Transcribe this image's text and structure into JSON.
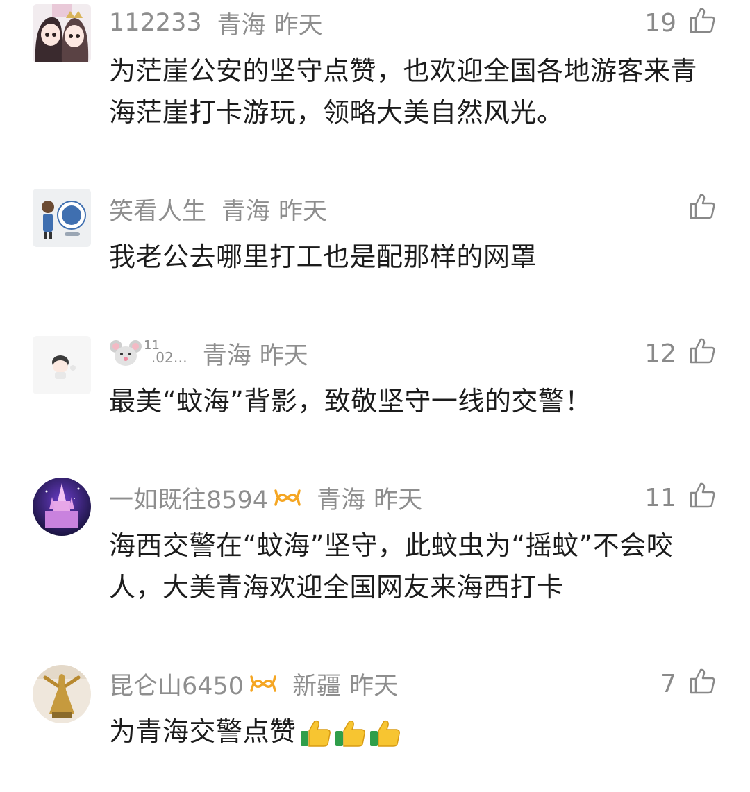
{
  "comments": [
    {
      "username": "112233",
      "location": "青海",
      "time": "昨天",
      "likes": "19",
      "text": "为茫崖公安的坚守点赞，也欢迎全国各地游客来青海茫崖打卡游玩，领略大美自然风光。",
      "avatar": "anime-couple-avatar"
    },
    {
      "username": "笑看人生",
      "location": "青海",
      "time": "昨天",
      "likes": "",
      "text": "我老公去哪里打工也是配那样的网罩",
      "avatar": "cartoon-character-avatar"
    },
    {
      "username_emoji": "mouse-face-emoji",
      "username_sup": "11",
      "username_sub": ".02…",
      "location": "青海",
      "time": "昨天",
      "likes": "12",
      "text": "最美“蚊海”背影，致敬坚守一线的交警！",
      "avatar": "small-doll-avatar"
    },
    {
      "username": "一如既往8594",
      "badge": "orange-vip-badge",
      "location": "青海",
      "time": "昨天",
      "likes": "11",
      "text": "海西交警在“蚊海”坚守，此蚊虫为“摇蚊”不会咬人，大美青海欢迎全国网友来海西打卡",
      "avatar": "purple-castle-avatar"
    },
    {
      "username": "昆仑山6450",
      "badge": "orange-vip-badge",
      "location": "新疆",
      "time": "昨天",
      "likes": "7",
      "text": "为青海交警点赞",
      "text_emoji": "thumbs-up-emoji-x3",
      "avatar": "statue-avatar"
    }
  ],
  "colors": {
    "meta_text": "#8e8e8e",
    "body_text": "#1c1c1c",
    "badge": "#f5a623",
    "like_icon": "#888888"
  },
  "icons": {
    "like": "thumbs-up-outline-icon",
    "badge": "orange-vip-badge"
  }
}
